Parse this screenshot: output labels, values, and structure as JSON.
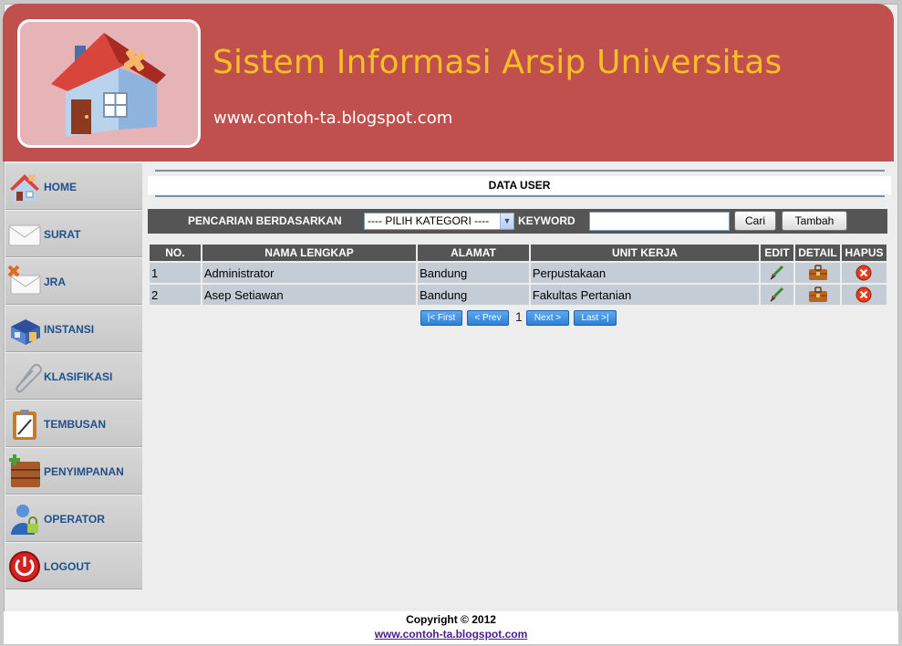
{
  "header": {
    "title": "Sistem Informasi Arsip Universitas",
    "url": "www.contoh-ta.blogspot.com",
    "logo_icon": "house-icon"
  },
  "sidebar": {
    "items": [
      {
        "label": "HOME",
        "icon": "home-icon"
      },
      {
        "label": "SURAT",
        "icon": "envelope-icon"
      },
      {
        "label": "JRA",
        "icon": "envelope-delete-icon"
      },
      {
        "label": "INSTANSI",
        "icon": "building-icon"
      },
      {
        "label": "KLASIFIKASI",
        "icon": "paperclip-icon"
      },
      {
        "label": "TEMBUSAN",
        "icon": "clipboard-icon"
      },
      {
        "label": "PENYIMPANAN",
        "icon": "storage-box-icon"
      },
      {
        "label": "OPERATOR",
        "icon": "user-lock-icon"
      },
      {
        "label": "LOGOUT",
        "icon": "power-icon"
      }
    ]
  },
  "main": {
    "heading": "DATA USER",
    "search": {
      "label": "PENCARIAN BERDASARKAN",
      "category_selected": "---- PILIH KATEGORI ----",
      "keyword_label": "KEYWORD",
      "keyword_value": "",
      "search_button": "Cari",
      "add_button": "Tambah"
    },
    "table": {
      "columns": [
        "NO.",
        "NAMA LENGKAP",
        "ALAMAT",
        "UNIT KERJA",
        "EDIT",
        "DETAIL",
        "HAPUS"
      ],
      "rows": [
        {
          "no": "1",
          "nama": "Administrator",
          "alamat": "Bandung",
          "unit": "Perpustakaan"
        },
        {
          "no": "2",
          "nama": "Asep Setiawan",
          "alamat": "Bandung",
          "unit": "Fakultas Pertanian"
        }
      ],
      "row_icons": {
        "edit": "brush-icon",
        "detail": "briefcase-icon",
        "delete": "delete-x-icon"
      }
    },
    "pager": {
      "first": "First",
      "prev": "Prev",
      "current": "1",
      "next": "Next",
      "last": "Last"
    }
  },
  "footer": {
    "copyright": "Copyright © 2012",
    "link": "www.contoh-ta.blogspot.com"
  },
  "colors": {
    "header_bg": "#c0504d",
    "title": "#f9be23",
    "bar_bg": "#555555",
    "row_bg": "#c4ccd6",
    "menu_text": "#1f4f8c"
  }
}
